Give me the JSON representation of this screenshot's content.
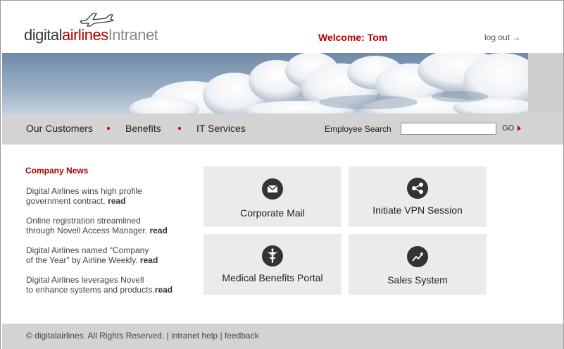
{
  "header": {
    "logo_part1": "digital",
    "logo_part2": "airlines",
    "logo_part3": "Intranet",
    "welcome": "Welcome: Tom",
    "logout": "log out →"
  },
  "nav": {
    "items": [
      {
        "label": "Our Customers"
      },
      {
        "label": "Benefits"
      },
      {
        "label": "IT Services"
      }
    ],
    "search_label": "Employee Search",
    "search_value": "",
    "go_label": "GO"
  },
  "news": {
    "title": "Company News",
    "items": [
      {
        "line1": "Digital Airlines wins high profile",
        "line2": "government contract.",
        "link": "read"
      },
      {
        "line1": "Online registration streamlined",
        "line2": "through Novell Access Manager.",
        "link": "read"
      },
      {
        "line1": "Digital Airlines named \"Company",
        "line2": "of the Year\"  by Airline Weekly.",
        "link": "read"
      },
      {
        "line1": "Digital Airlines leverages Novell",
        "line2": "to enhance systems and products.",
        "link": "read"
      }
    ]
  },
  "tiles": [
    {
      "label": "Corporate Mail",
      "icon": "mail-icon"
    },
    {
      "label": "Initiate VPN Session",
      "icon": "share-network-icon"
    },
    {
      "label": "Medical Benefits Portal",
      "icon": "caduceus-icon"
    },
    {
      "label": "Sales System",
      "icon": "trend-up-icon"
    }
  ],
  "footer": {
    "copyright": "© digitalairlines.  All Rights Reserved.",
    "sep1": " | ",
    "help": "intranet help",
    "sep2": " | ",
    "feedback": "feedback"
  },
  "colors": {
    "accent_red": "#b00000",
    "nav_gray": "#d3d3d3",
    "tile_gray": "#ebebeb",
    "icon_dark": "#333333"
  }
}
